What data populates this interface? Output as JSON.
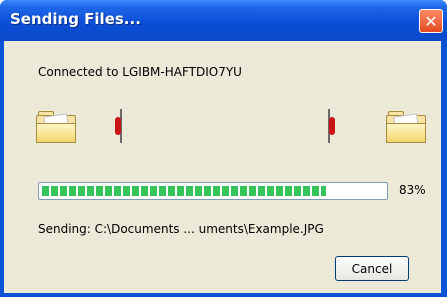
{
  "window": {
    "title": "Sending Files...",
    "close_icon": "close-icon"
  },
  "dialog": {
    "connected_text": "Connected to LGIBM-HAFTDIO7YU",
    "progress_percent": 83,
    "progress_text": "83%",
    "sending_text": "Sending: C:\\Documents ... uments\\Example.JPG",
    "cancel_label": "Cancel"
  },
  "icons": {
    "source_folder": "folder-icon",
    "dest_folder": "folder-icon",
    "transfer_left": "transfer-indicator-icon",
    "transfer_right": "transfer-indicator-icon"
  },
  "colors": {
    "titlebar": "#0a53d6",
    "client_bg": "#ece9d8",
    "progress_green": "#35c45a",
    "close_red": "#e24b1e"
  }
}
